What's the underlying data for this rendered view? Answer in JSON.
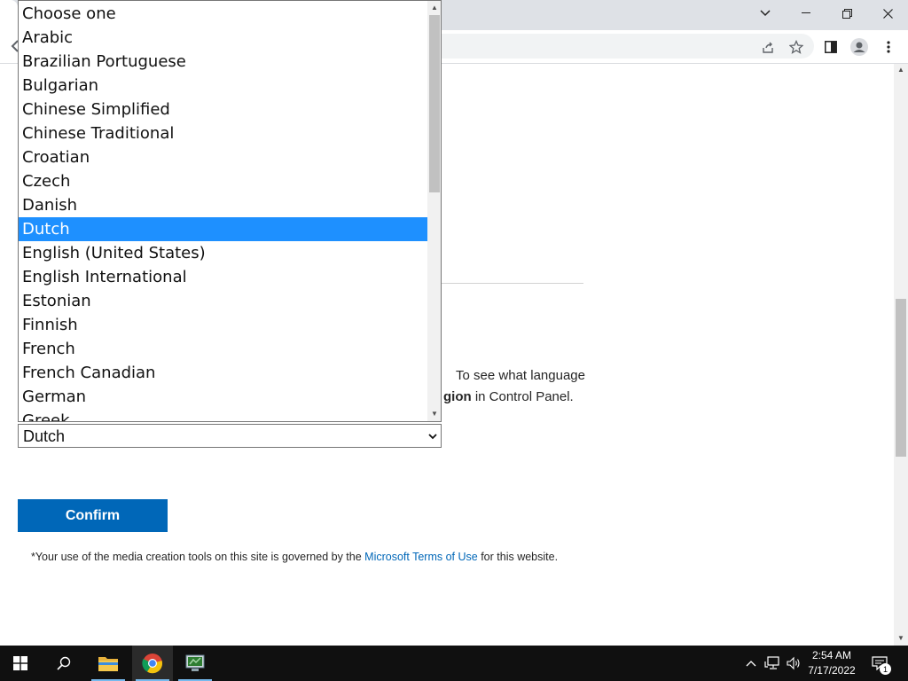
{
  "dropdown": {
    "options": [
      "Choose one",
      "Arabic",
      "Brazilian Portuguese",
      "Bulgarian",
      "Chinese Simplified",
      "Chinese Traditional",
      "Croatian",
      "Czech",
      "Danish",
      "Dutch",
      "English (United States)",
      "English International",
      "Estonian",
      "Finnish",
      "French",
      "French Canadian",
      "German",
      "Greek"
    ],
    "highlighted_index": 9
  },
  "page": {
    "description_line1": "To see what language",
    "description_line2_bold": "gion",
    "description_line2_rest": " in Control Panel.",
    "select_value": "Dutch",
    "confirm_label": "Confirm",
    "footnote_prefix": "*Your use of the media creation tools on this site is governed by the ",
    "footnote_link": "Microsoft Terms of Use",
    "footnote_suffix": " for this website."
  },
  "taskbar": {
    "time": "2:54 AM",
    "date": "7/17/2022",
    "notification_count": "1"
  },
  "colors": {
    "accent": "#0067b8",
    "highlight": "#1e90ff",
    "taskbar": "#101010"
  }
}
